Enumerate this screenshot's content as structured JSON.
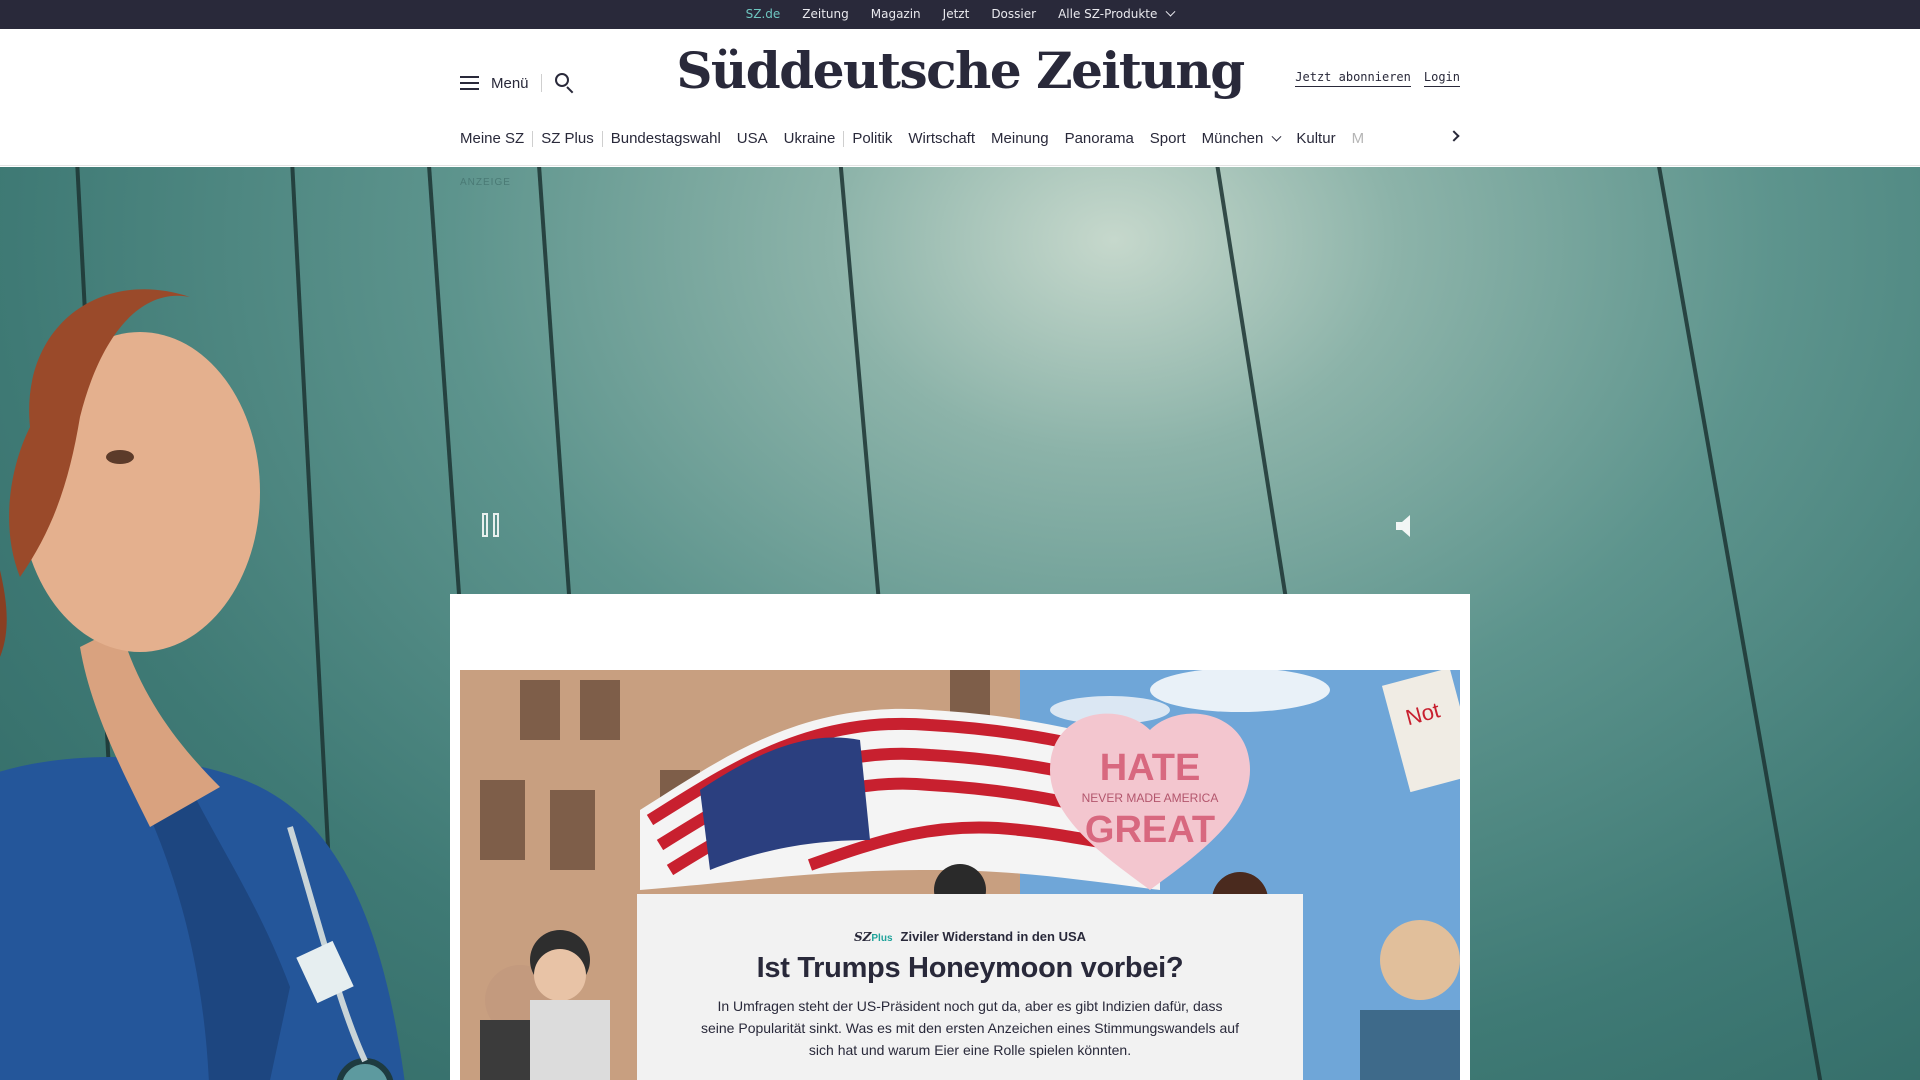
{
  "topbar": {
    "items": [
      {
        "label": "SZ.de",
        "active": true
      },
      {
        "label": "Zeitung"
      },
      {
        "label": "Magazin"
      },
      {
        "label": "Jetzt"
      },
      {
        "label": "Dossier"
      },
      {
        "label": "Alle SZ-Produkte",
        "dropdown": true
      }
    ]
  },
  "header": {
    "menu_label": "Menü",
    "search_icon": "search-icon",
    "logo": "Süddeutsche Zeitung",
    "subscribe_label": "Jetzt abonnieren",
    "login_label": "Login"
  },
  "nav": {
    "items": [
      "Meine SZ",
      "SZ Plus",
      "Bundestagswahl",
      "USA",
      "Ukraine",
      "Politik",
      "Wirtschaft",
      "Meinung",
      "Panorama",
      "Sport",
      "München",
      "Kultur",
      "M"
    ]
  },
  "ad": {
    "label": "ANZEIGE",
    "pause_icon": "pause-icon",
    "sound_icon": "speaker-icon"
  },
  "teaser": {
    "brand": "SZ",
    "brand_suffix": "Plus",
    "kicker": "Ziviler Widerstand in den USA",
    "headline": "Ist Trumps Honeymoon vorbei?",
    "text": "In Umfragen steht der US-Präsident noch gut da, aber es gibt Indizien dafür, dass seine Popularität sinkt. Was es mit den ersten Anzeichen eines Stimmungswandels auf sich hat und warum Eier eine Rolle spielen könnten.",
    "sign_text_1": "HATE",
    "sign_text_2": "NEVER MADE AMERICA",
    "sign_text_3": "GREAT",
    "sign_text_4": "Not"
  },
  "colors": {
    "dark": "#29293a",
    "accent": "#6ec6c0",
    "szplus": "#1fa39b"
  }
}
